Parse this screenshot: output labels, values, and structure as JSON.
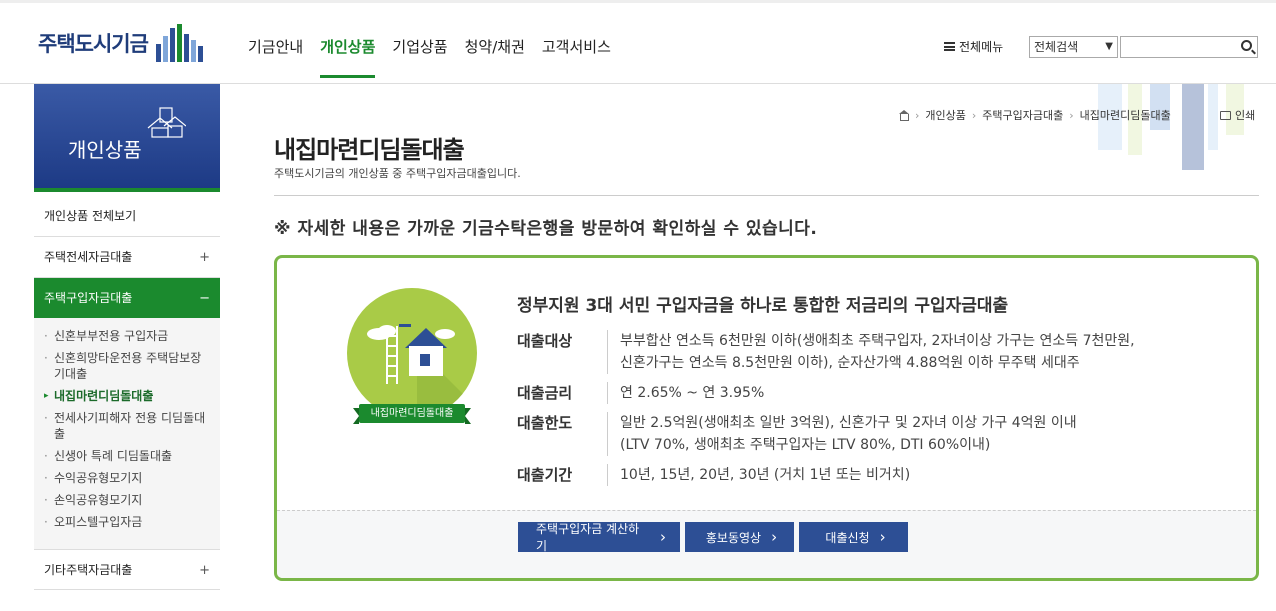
{
  "header": {
    "logo_text": "주택도시기금",
    "gnb": [
      "기금안내",
      "개인상품",
      "기업상품",
      "청약/채권",
      "고객서비스"
    ],
    "active_gnb_index": 1,
    "all_menu": "전체메뉴",
    "search_select": "전체검색",
    "search_value": ""
  },
  "sidebar": {
    "title": "개인상품",
    "items": [
      {
        "label": "개인상품 전체보기",
        "toggle": ""
      },
      {
        "label": "주택전세자금대출",
        "toggle": "+"
      },
      {
        "label": "주택구입자금대출",
        "toggle": "−"
      },
      {
        "label": "기타주택자금대출",
        "toggle": "+"
      }
    ],
    "sub_items": [
      "신혼부부전용 구입자금",
      "신혼희망타운전용 주택담보장기대출",
      "내집마련디딤돌대출",
      "전세사기피해자 전용 디딤돌대출",
      "신생아 특례 디딤돌대출",
      "수익공유형모기지",
      "손익공유형모기지",
      "오피스텔구입자금"
    ],
    "active_sub_index": 2
  },
  "breadcrumb": [
    "개인상품",
    "주택구입자금대출",
    "내집마련디딤돌대출"
  ],
  "print_label": "인쇄",
  "page": {
    "title": "내집마련디딤돌대출",
    "description": "주택도시기금의 개인상품 중 주택구입자금대출입니다.",
    "notice": "※ 자세한 내용은 가까운 기금수탁은행을 방문하여 확인하실 수 있습니다."
  },
  "product": {
    "badge_label": "내집마련디딤돌대출",
    "headline": "정부지원 3대 서민 구입자금을 하나로 통합한 저금리의 구입자금대출",
    "rows": [
      {
        "label": "대출대상",
        "value_lines": [
          "부부합산 연소득 6천만원 이하(생애최초 주택구입자, 2자녀이상 가구는 연소득 7천만원,",
          "신혼가구는 연소득 8.5천만원 이하), 순자산가액 4.88억원 이하 무주택 세대주"
        ]
      },
      {
        "label": "대출금리",
        "value_lines": [
          "연 2.65% ~ 연 3.95%"
        ]
      },
      {
        "label": "대출한도",
        "value_lines": [
          "일반 2.5억원(생애최초 일반 3억원), 신혼가구 및 2자녀 이상 가구 4억원 이내",
          "(LTV 70%, 생애최초 주택구입자는 LTV 80%, DTI 60%이내)"
        ]
      },
      {
        "label": "대출기간",
        "value_lines": [
          "10년, 15년, 20년, 30년 (거치 1년 또는 비거치)"
        ]
      }
    ],
    "buttons": [
      "주택구입자금 계산하기",
      "홍보동영상",
      "대출신청"
    ]
  },
  "colors": {
    "brand_green": "#1b8a2e",
    "brand_blue": "#2d4f95",
    "box_border": "#7ab648",
    "badge_bg": "#a9cb47"
  }
}
